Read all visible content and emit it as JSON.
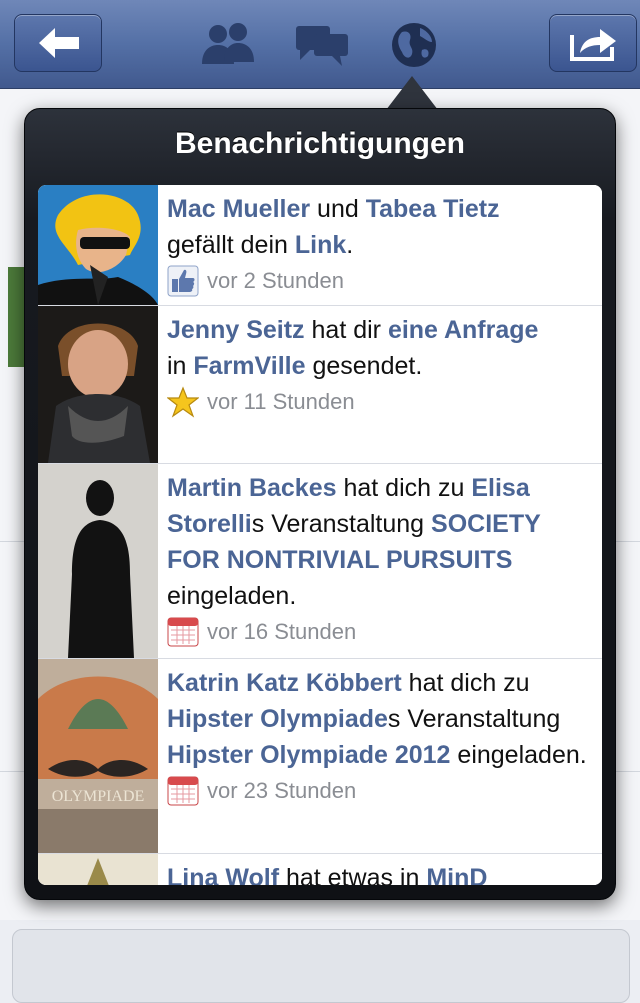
{
  "popover": {
    "title": "Benachrichtigungen"
  },
  "notifications": [
    {
      "actor1": "Mac Mueller",
      "mid1": " und ",
      "actor2": "Tabea Tietz",
      "line2_text": "gefällt dein ",
      "object": "Link",
      "tail": ".",
      "meta_icon": "like-icon",
      "time": "vor 2 Stunden"
    },
    {
      "actor": "Jenny Seitz",
      "mid1": " hat dir ",
      "object": "eine Anfrage",
      "mid2": " in ",
      "app": "FarmVille",
      "tail": " gesendet.",
      "meta_icon": "star-icon",
      "time": "vor 11 Stunden"
    },
    {
      "actor": "Martin Backes",
      "mid1": " hat dich zu ",
      "host": "Elisa Storelli",
      "mid2": "s Veranstaltung ",
      "event": "SOCIETY FOR NONTRIVIAL PURSUITS",
      "tail": " eingeladen.",
      "meta_icon": "calendar-icon",
      "time": "vor 16 Stunden"
    },
    {
      "actor": "Katrin Katz Köbbert",
      "mid1": " hat dich zu ",
      "host": "Hipster Olympiade",
      "mid2": "s Veranstaltung ",
      "event": "Hipster Olympiade 2012",
      "tail": " eingeladen.",
      "avatar_text": "OLYMPIADE",
      "meta_icon": "calendar-icon",
      "time": "vor 23 Stunden"
    },
    {
      "actor": "Lina Wolf",
      "mid1": " hat etwas in ",
      "object": "MinD"
    }
  ],
  "colors": {
    "link": "#4b6595",
    "navbar": "#4d68a0",
    "popover": "#15181d"
  },
  "navbar_icons": [
    "back-arrow-icon",
    "friends-icon",
    "messages-icon",
    "globe-icon",
    "share-icon"
  ]
}
